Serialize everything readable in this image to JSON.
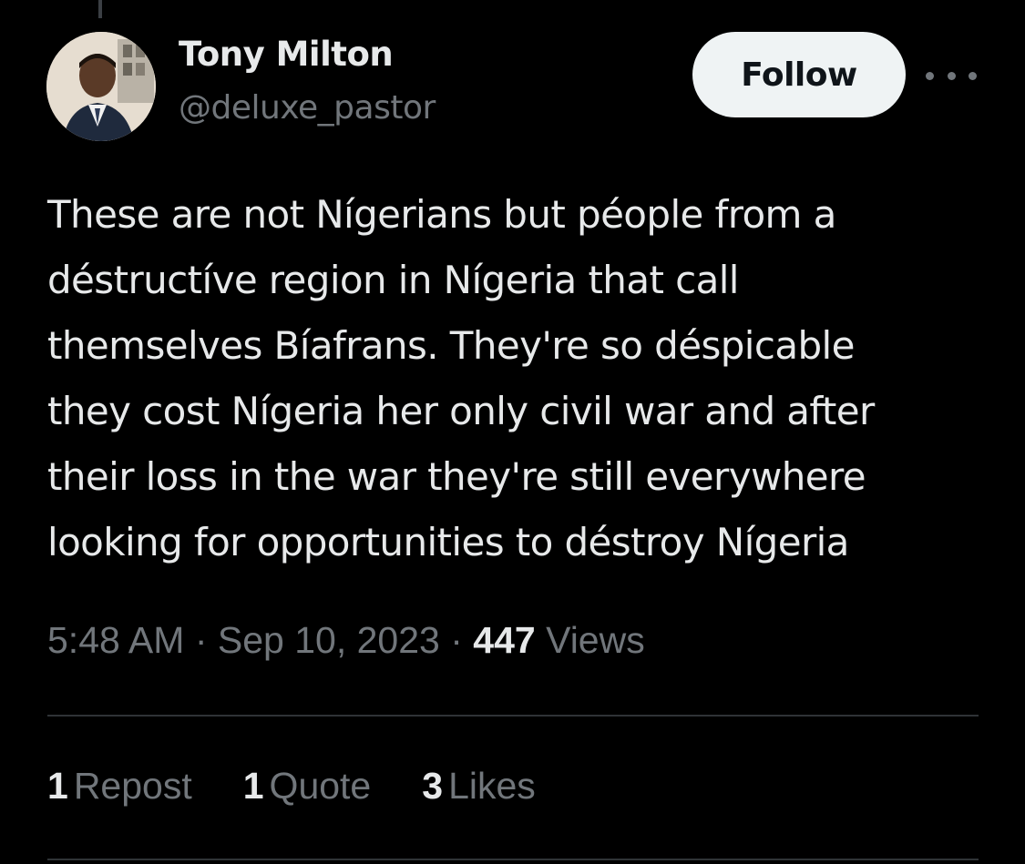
{
  "author": {
    "name": "Tony Milton",
    "handle": "@deluxe_pastor"
  },
  "actions": {
    "follow_label": "Follow",
    "more_icon": "more-horizontal-icon"
  },
  "tweet": {
    "lines": [
      "These are not Nígerians but péople from a",
      "déstructíve region in Nígeria that call",
      "themselves Bíafrans. They're so déspicable",
      "they cost Nígeria her only civil war and after",
      "their loss in the war they're still everywhere",
      "looking for opportunities to déstroy Nígeria"
    ],
    "time": "5:48 AM",
    "sep1": " · ",
    "date": "Sep 10, 2023",
    "sep2": " · ",
    "views_count": "447",
    "views_label": "Views"
  },
  "stats": {
    "reposts_count": "1",
    "reposts_label": "Repost",
    "quotes_count": "1",
    "quotes_label": "Quote",
    "likes_count": "3",
    "likes_label": "Likes"
  },
  "colors": {
    "background": "#000000",
    "text_primary": "#e7e9ea",
    "text_secondary": "#71767b",
    "follow_bg": "#eff3f4",
    "divider": "#2f3336"
  }
}
